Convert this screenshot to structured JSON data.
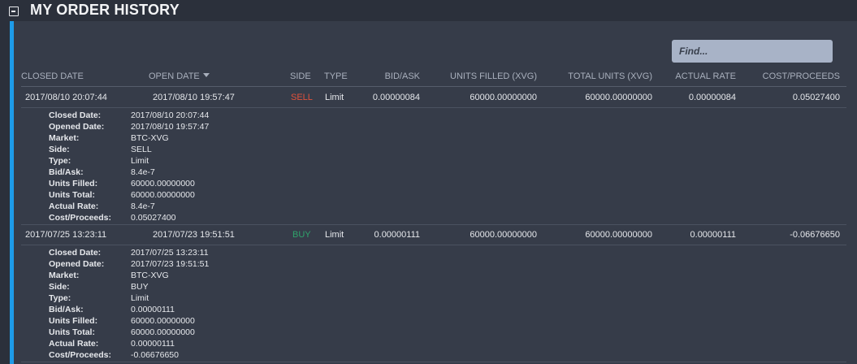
{
  "title": "MY ORDER HISTORY",
  "search": {
    "placeholder": "Find..."
  },
  "columns": {
    "closed_date": "CLOSED DATE",
    "open_date": "OPEN DATE",
    "side": "SIDE",
    "type": "TYPE",
    "bid_ask": "BID/ASK",
    "units_filled": "UNITS FILLED (XVG)",
    "total_units": "TOTAL UNITS (XVG)",
    "actual_rate": "ACTUAL RATE",
    "cost_proceeds": "COST/PROCEEDS"
  },
  "detail_labels": {
    "closed_date": "Closed Date:",
    "opened_date": "Opened Date:",
    "market": "Market:",
    "side": "Side:",
    "type": "Type:",
    "bid_ask": "Bid/Ask:",
    "units_filled": "Units Filled:",
    "units_total": "Units Total:",
    "actual_rate": "Actual Rate:",
    "cost_proceeds": "Cost/Proceeds:"
  },
  "colors": {
    "accent": "#1e9be8",
    "sell": "#e0513b",
    "buy": "#2fa36b"
  },
  "orders": [
    {
      "closed": "2017/08/10 20:07:44",
      "opened": "2017/08/10 19:57:47",
      "side": "SELL",
      "type": "Limit",
      "bid_ask": "0.00000084",
      "units_filled": "60000.00000000",
      "total_units": "60000.00000000",
      "actual_rate": "0.00000084",
      "cost_proceeds": "0.05027400",
      "detail": {
        "closed_date": "2017/08/10 20:07:44",
        "opened_date": "2017/08/10 19:57:47",
        "market": "BTC-XVG",
        "side": "SELL",
        "type": "Limit",
        "bid_ask": "8.4e-7",
        "units_filled": "60000.00000000",
        "units_total": "60000.00000000",
        "actual_rate": "8.4e-7",
        "cost_proceeds": "0.05027400"
      }
    },
    {
      "closed": "2017/07/25 13:23:11",
      "opened": "2017/07/23 19:51:51",
      "side": "BUY",
      "type": "Limit",
      "bid_ask": "0.00000111",
      "units_filled": "60000.00000000",
      "total_units": "60000.00000000",
      "actual_rate": "0.00000111",
      "cost_proceeds": "-0.06676650",
      "detail": {
        "closed_date": "2017/07/25 13:23:11",
        "opened_date": "2017/07/23 19:51:51",
        "market": "BTC-XVG",
        "side": "BUY",
        "type": "Limit",
        "bid_ask": "0.00000111",
        "units_filled": "60000.00000000",
        "units_total": "60000.00000000",
        "actual_rate": "0.00000111",
        "cost_proceeds": "-0.06676650"
      }
    }
  ]
}
